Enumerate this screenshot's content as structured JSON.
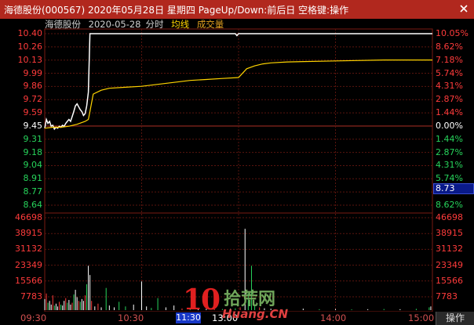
{
  "window": {
    "title": "海德股份(000567) 2020年05月28日 星期四 PageUp/Down:前后日 空格键:操作"
  },
  "header": {
    "stock_name": "海德股份",
    "date": "2020-05-28",
    "chart_kind": "分时",
    "avg_line_label": "均线",
    "volume_label": "成交量"
  },
  "price_axis": {
    "left_labels": [
      "10.40",
      "10.26",
      "10.13",
      "9.99",
      "9.86",
      "9.72",
      "9.59",
      "9.45",
      "9.31",
      "9.18",
      "9.04",
      "8.91",
      "8.77",
      "8.64"
    ],
    "right_labels": [
      "10.05%",
      "8.62%",
      "7.18%",
      "5.74%",
      "4.31%",
      "2.87%",
      "1.44%",
      "0.00%",
      "1.44%",
      "2.87%",
      "4.31%",
      "5.74%",
      "7.18%",
      "8.62%"
    ],
    "current_price": "8.73"
  },
  "volume_axis": {
    "labels": [
      "46698",
      "38915",
      "31132",
      "23349",
      "15566",
      "7783"
    ]
  },
  "time_axis": {
    "labels": [
      "09:30",
      "10:30",
      "11:30",
      "13:00",
      "14:00",
      "15:00"
    ],
    "operate_button": "操作"
  },
  "watermark": {
    "number": "10",
    "cn": "拾荒网",
    "en": "Huang.CN"
  },
  "colors": {
    "price_line": "#ffffff",
    "avg_line": "#ffd400",
    "up": "#ff3b3b",
    "down": "#27d45b",
    "grid": "#7a1a12"
  },
  "chart_data": {
    "type": "line",
    "prev_close": 9.45,
    "ylim": [
      8.64,
      10.4
    ],
    "x_domain_minutes": [
      0,
      240
    ],
    "series": [
      {
        "name": "",
        "points": [
          [
            0,
            9.43
          ],
          [
            1,
            9.52
          ],
          [
            2,
            9.48
          ],
          [
            3,
            9.5
          ],
          [
            4,
            9.45
          ],
          [
            5,
            9.46
          ],
          [
            6,
            9.42
          ],
          [
            7,
            9.44
          ],
          [
            8,
            9.43
          ],
          [
            9,
            9.45
          ],
          [
            10,
            9.44
          ],
          [
            11,
            9.46
          ],
          [
            12,
            9.45
          ],
          [
            13,
            9.48
          ],
          [
            14,
            9.5
          ],
          [
            15,
            9.52
          ],
          [
            16,
            9.5
          ],
          [
            17,
            9.55
          ],
          [
            18,
            9.6
          ],
          [
            19,
            9.66
          ],
          [
            20,
            9.68
          ],
          [
            21,
            9.65
          ],
          [
            22,
            9.62
          ],
          [
            23,
            9.6
          ],
          [
            24,
            9.56
          ],
          [
            25,
            9.58
          ],
          [
            26,
            9.66
          ],
          [
            27,
            9.8
          ],
          [
            28,
            10.4
          ],
          [
            30,
            10.4
          ],
          [
            60,
            10.4
          ],
          [
            90,
            10.4
          ],
          [
            110,
            10.4
          ],
          [
            118,
            10.4
          ],
          [
            119,
            10.38
          ],
          [
            120,
            10.4
          ],
          [
            150,
            10.4
          ],
          [
            180,
            10.4
          ],
          [
            210,
            10.4
          ],
          [
            240,
            10.4
          ]
        ]
      },
      {
        "name": "",
        "points": [
          [
            0,
            9.43
          ],
          [
            5,
            9.44
          ],
          [
            10,
            9.44
          ],
          [
            15,
            9.45
          ],
          [
            20,
            9.47
          ],
          [
            25,
            9.5
          ],
          [
            27,
            9.52
          ],
          [
            28,
            9.6
          ],
          [
            30,
            9.78
          ],
          [
            35,
            9.82
          ],
          [
            40,
            9.84
          ],
          [
            50,
            9.85
          ],
          [
            60,
            9.86
          ],
          [
            70,
            9.88
          ],
          [
            80,
            9.9
          ],
          [
            90,
            9.92
          ],
          [
            100,
            9.93
          ],
          [
            110,
            9.94
          ],
          [
            120,
            9.95
          ],
          [
            125,
            10.04
          ],
          [
            130,
            10.07
          ],
          [
            135,
            10.09
          ],
          [
            140,
            10.1
          ],
          [
            150,
            10.11
          ],
          [
            180,
            10.12
          ],
          [
            210,
            10.13
          ],
          [
            240,
            10.13
          ]
        ]
      }
    ],
    "volume": {
      "ylim": [
        0,
        50000
      ],
      "bars": [
        [
          0,
          6000
        ],
        [
          1,
          9000
        ],
        [
          2,
          4000
        ],
        [
          3,
          5000
        ],
        [
          4,
          3000
        ],
        [
          5,
          8000
        ],
        [
          6,
          2500
        ],
        [
          7,
          3500
        ],
        [
          8,
          2000
        ],
        [
          9,
          4500
        ],
        [
          10,
          3000
        ],
        [
          11,
          2500
        ],
        [
          12,
          5000
        ],
        [
          13,
          6500
        ],
        [
          14,
          4000
        ],
        [
          15,
          5500
        ],
        [
          16,
          3000
        ],
        [
          17,
          4000
        ],
        [
          18,
          8500
        ],
        [
          19,
          11000
        ],
        [
          20,
          7000
        ],
        [
          21,
          5000
        ],
        [
          22,
          4500
        ],
        [
          23,
          6000
        ],
        [
          24,
          5000
        ],
        [
          25,
          8000
        ],
        [
          26,
          14000
        ],
        [
          27,
          24000
        ],
        [
          28,
          19000
        ],
        [
          29,
          5000
        ],
        [
          31,
          2000
        ],
        [
          33,
          3500
        ],
        [
          35,
          1500
        ],
        [
          38,
          12000
        ],
        [
          40,
          2500
        ],
        [
          43,
          1500
        ],
        [
          46,
          4500
        ],
        [
          50,
          2000
        ],
        [
          55,
          3000
        ],
        [
          60,
          15500
        ],
        [
          63,
          2000
        ],
        [
          66,
          1200
        ],
        [
          70,
          6500
        ],
        [
          75,
          1500
        ],
        [
          80,
          2500
        ],
        [
          85,
          900
        ],
        [
          90,
          1200
        ],
        [
          95,
          800
        ],
        [
          100,
          700
        ],
        [
          105,
          700
        ],
        [
          110,
          600
        ],
        [
          115,
          800
        ],
        [
          118,
          1000
        ],
        [
          121,
          1500
        ],
        [
          124,
          44000
        ],
        [
          126,
          9000
        ],
        [
          128,
          24000
        ],
        [
          130,
          2500
        ],
        [
          133,
          1500
        ],
        [
          136,
          1000
        ],
        [
          140,
          800
        ],
        [
          150,
          600
        ],
        [
          160,
          800
        ],
        [
          170,
          500
        ],
        [
          180,
          600
        ],
        [
          190,
          400
        ],
        [
          200,
          500
        ],
        [
          210,
          600
        ],
        [
          220,
          500
        ],
        [
          230,
          700
        ],
        [
          238,
          1500
        ],
        [
          239,
          2000
        ]
      ]
    }
  }
}
